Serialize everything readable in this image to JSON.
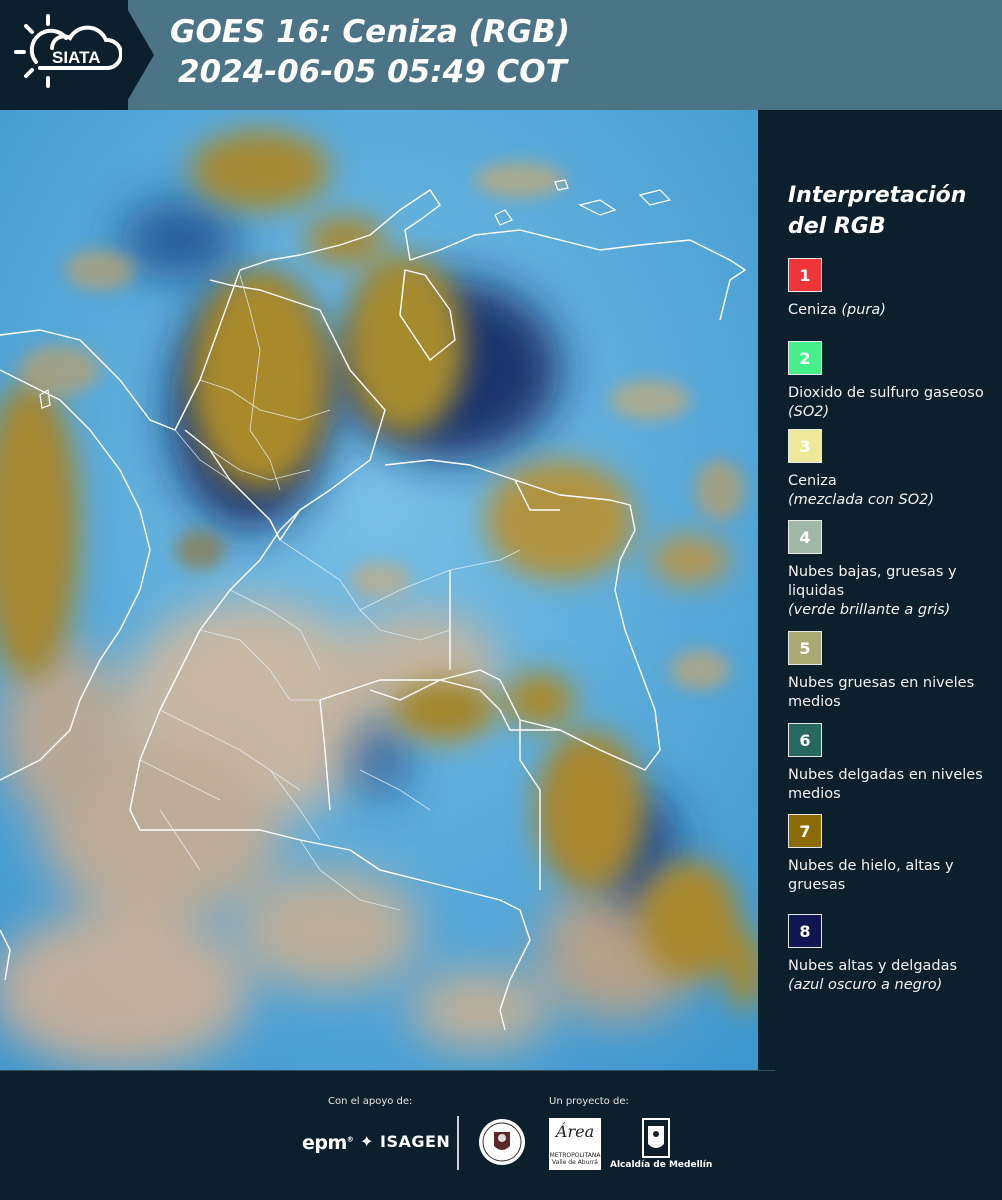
{
  "header": {
    "logo_text": "SIATA",
    "title_line1": "GOES 16: Ceniza (RGB)",
    "title_line2": "2024-06-05 05:49 COT"
  },
  "legend": {
    "title": "Interpretación del RGB",
    "items": [
      {
        "num": "1",
        "color": "#f03539",
        "text_color": "#ffffff",
        "label": "Ceniza",
        "label_italic": "(pura)",
        "sub": ""
      },
      {
        "num": "2",
        "color": "#45f08c",
        "text_color": "#ffffff",
        "label": "Dioxido de sulfuro gaseoso",
        "label_italic": "(SO2)",
        "sub": ""
      },
      {
        "num": "3",
        "color": "#ece99a",
        "text_color": "#ffffff",
        "label": "Ceniza",
        "label_italic": "",
        "sub": "(mezclada con SO2)"
      },
      {
        "num": "4",
        "color": "#9eb7a6",
        "text_color": "#ffffff",
        "label": "Nubes bajas, gruesas y liquidas",
        "label_italic": "",
        "sub": "(verde brillante a gris)"
      },
      {
        "num": "5",
        "color": "#a8aa72",
        "text_color": "#ffffff",
        "label": "Nubes gruesas en niveles medios",
        "label_italic": "",
        "sub": ""
      },
      {
        "num": "6",
        "color": "#29685f",
        "text_color": "#ffffff",
        "label": "Nubes delgadas en niveles medios",
        "label_italic": "",
        "sub": ""
      },
      {
        "num": "7",
        "color": "#8c6a06",
        "text_color": "#ffffff",
        "label": "Nubes de hielo, altas y gruesas",
        "label_italic": "",
        "sub": ""
      },
      {
        "num": "8",
        "color": "#0f1650",
        "text_color": "#ffffff",
        "label": "Nubes altas y delgadas",
        "label_italic": "",
        "sub": "(azul oscuro a negro)"
      }
    ]
  },
  "footer": {
    "support_label": "Con el apoyo de:",
    "project_label": "Un proyecto de:",
    "epm": "epm",
    "isagen": "ISAGEN",
    "area_name": "Área",
    "area_sub": "METROPOLITANA Valle de Aburrá",
    "alcaldia": "Alcaldía de Medellín"
  }
}
